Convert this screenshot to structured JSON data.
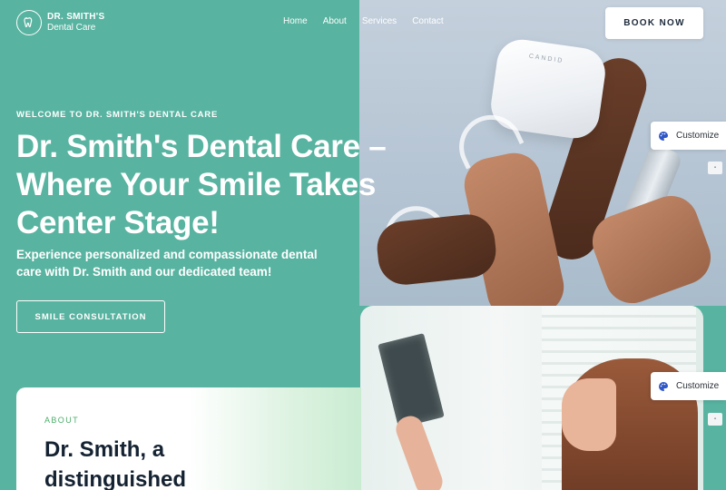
{
  "header": {
    "logo_line1": "DR. SMITH'S",
    "logo_line2": "Dental Care",
    "nav": [
      "Home",
      "About",
      "Services",
      "Contact"
    ],
    "cta": "BOOK NOW"
  },
  "hero": {
    "eyebrow": "WELCOME TO DR. SMITH'S DENTAL CARE",
    "headline": "Dr. Smith's Dental Care – Where Your Smile Takes Center Stage!",
    "subtext": "Experience personalized and compassionate dental care with Dr. Smith and our dedicated team!",
    "button": "SMILE CONSULTATION"
  },
  "photo_top": {
    "case_label": "CANDID"
  },
  "about": {
    "eyebrow": "ABOUT",
    "title": "Dr. Smith, a distinguished"
  },
  "customize": {
    "label": "Customize"
  },
  "colors": {
    "hero_bg": "#58b3a0",
    "accent_green": "#4cae6a",
    "dark_text": "#142232"
  }
}
